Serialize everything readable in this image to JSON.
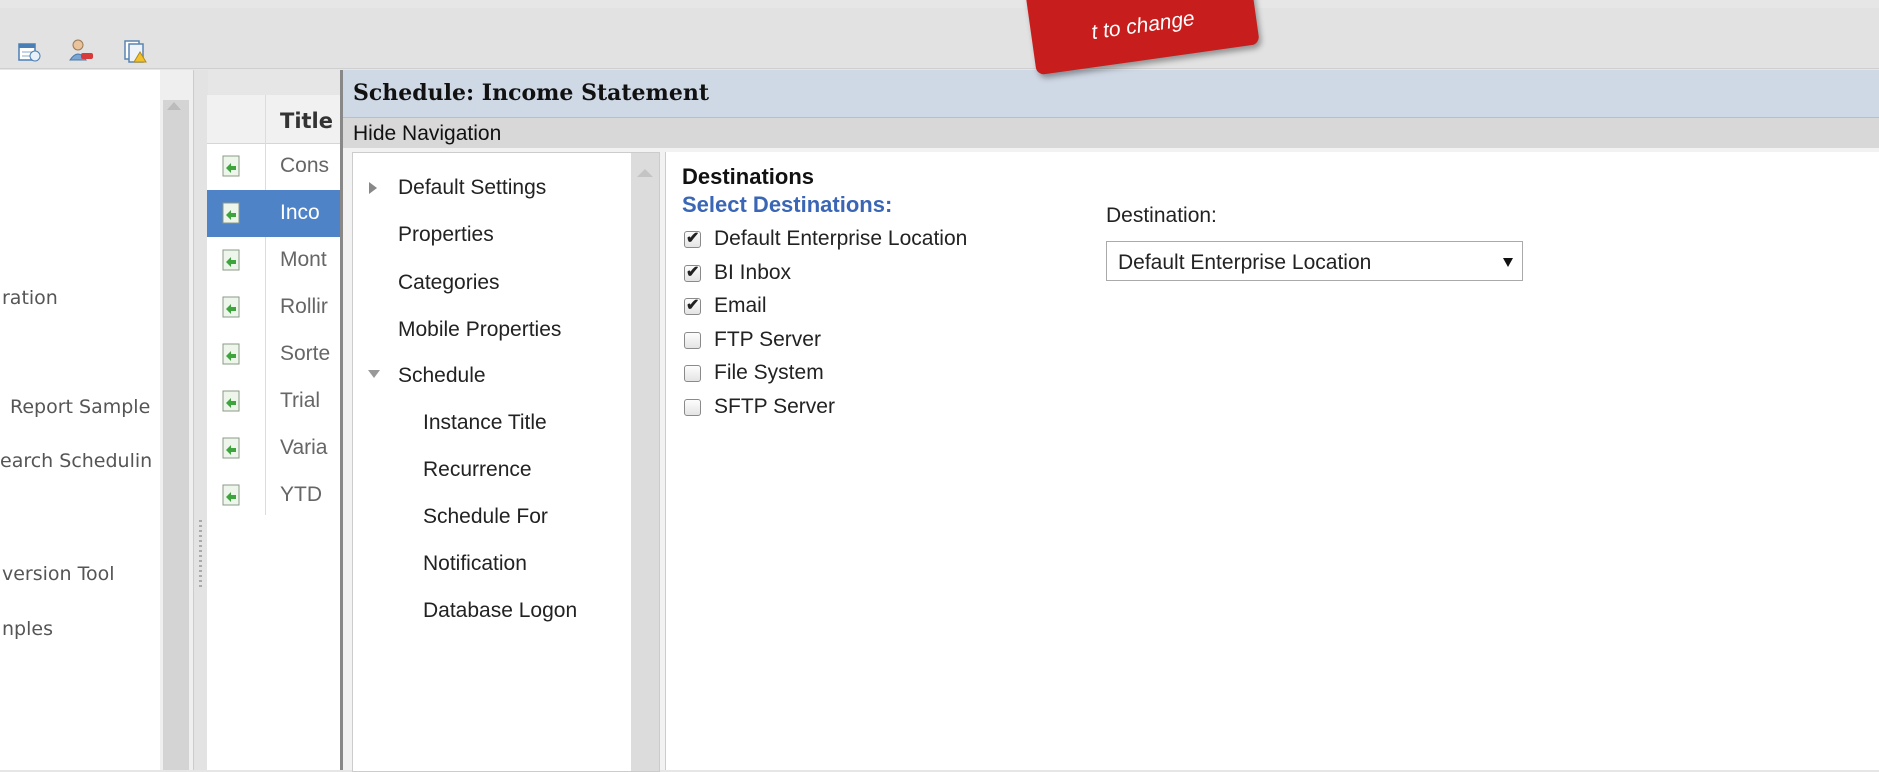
{
  "callout": {
    "text": "t to change"
  },
  "toolbar": {
    "icons": [
      "schedule-icon",
      "user-remove-icon",
      "document-warning-icon"
    ]
  },
  "left_tree": {
    "items": [
      "ration",
      "Report Sample",
      "earch Schedulin",
      "version Tool",
      "nples"
    ]
  },
  "report_table": {
    "header": "Title",
    "rows": [
      {
        "text": "Cons",
        "selected": false
      },
      {
        "text": "Inco",
        "selected": true
      },
      {
        "text": "Mont",
        "selected": false
      },
      {
        "text": "Rollir",
        "selected": false
      },
      {
        "text": "Sorte",
        "selected": false
      },
      {
        "text": "Trial",
        "selected": false
      },
      {
        "text": "Varia",
        "selected": false
      },
      {
        "text": "YTD",
        "selected": false
      }
    ]
  },
  "dialog": {
    "title": "Schedule: Income Statement",
    "hide_navigation": "Hide Navigation",
    "nav": {
      "default_settings": "Default Settings",
      "properties": "Properties",
      "categories": "Categories",
      "mobile_properties": "Mobile Properties",
      "schedule": "Schedule",
      "instance_title": "Instance Title",
      "recurrence": "Recurrence",
      "schedule_for": "Schedule For",
      "notification": "Notification",
      "database_logon": "Database Logon"
    },
    "content": {
      "heading": "Destinations",
      "subheading": "Select Destinations:",
      "options": [
        {
          "label": "Default Enterprise Location",
          "checked": true
        },
        {
          "label": "BI Inbox",
          "checked": true
        },
        {
          "label": "Email",
          "checked": true
        },
        {
          "label": "FTP Server",
          "checked": false
        },
        {
          "label": "File System",
          "checked": false
        },
        {
          "label": "SFTP Server",
          "checked": false
        }
      ],
      "destination_label": "Destination:",
      "destination_value": "Default Enterprise Location"
    }
  }
}
